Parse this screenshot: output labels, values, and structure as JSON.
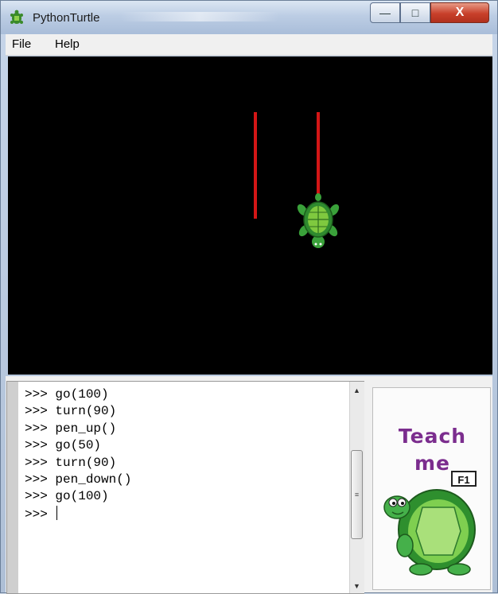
{
  "window": {
    "title": "PythonTurtle"
  },
  "titlebar_buttons": {
    "minimize": "—",
    "maximize": "□",
    "close": "X"
  },
  "menu": [
    "File",
    "Help"
  ],
  "canvas": {
    "background": "#000000",
    "pen_color": "#d41616",
    "turtle_color": "#3aa13a"
  },
  "console": {
    "lines": [
      ">>> go(100)",
      ">>> turn(90)",
      ">>> pen_up()",
      ">>> go(50)",
      ">>> turn(90)",
      ">>> pen_down()",
      ">>> go(100)"
    ],
    "prompt": ">>> "
  },
  "teach_panel": {
    "line1": "Teach",
    "line2": "me",
    "key": "F1"
  }
}
